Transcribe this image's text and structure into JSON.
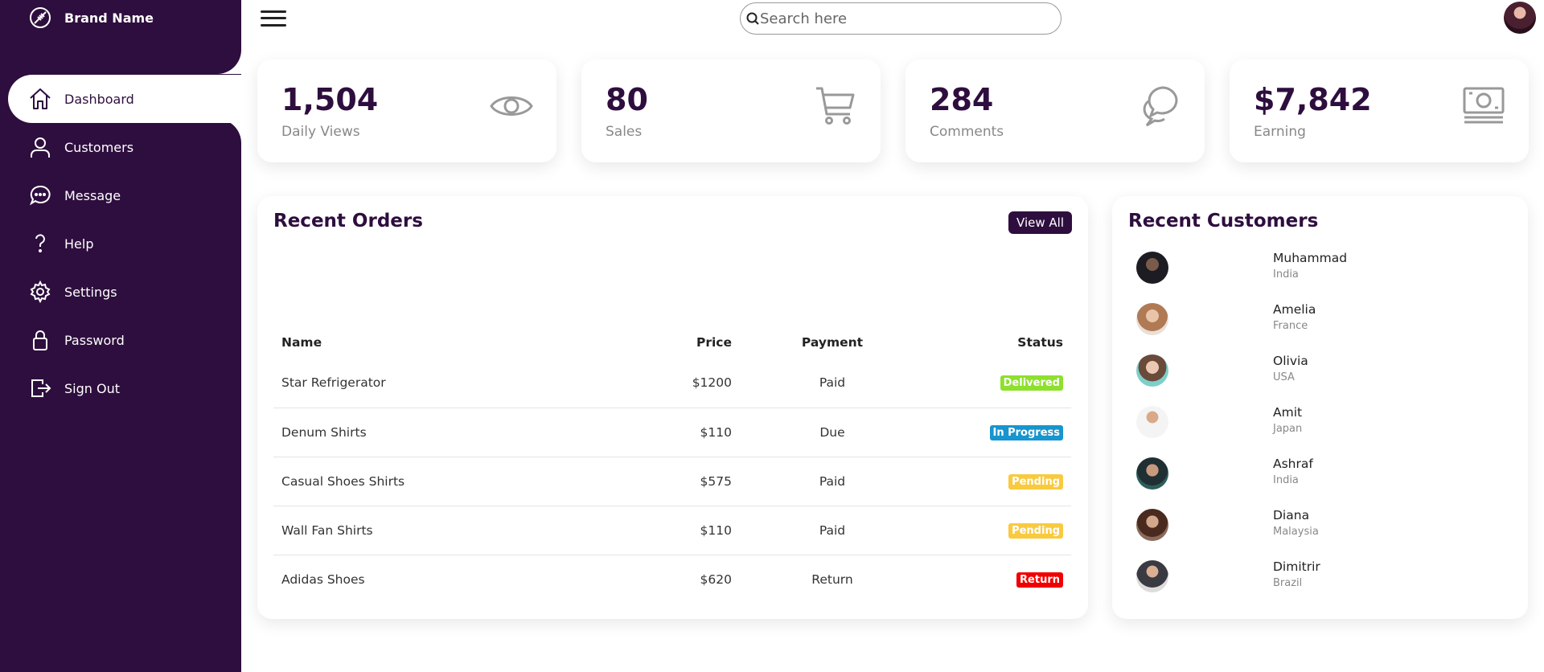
{
  "sidebar": {
    "brand": "Brand Name",
    "items": [
      {
        "label": "Dashboard",
        "icon": "home-icon"
      },
      {
        "label": "Customers",
        "icon": "person-icon"
      },
      {
        "label": "Message",
        "icon": "chat-icon"
      },
      {
        "label": "Help",
        "icon": "help-icon"
      },
      {
        "label": "Settings",
        "icon": "gear-icon"
      },
      {
        "label": "Password",
        "icon": "lock-icon"
      },
      {
        "label": "Sign Out",
        "icon": "sign-out-icon"
      }
    ],
    "colors": {
      "bg": "#2e0e3e",
      "active_bg": "#ffffff"
    }
  },
  "search": {
    "placeholder": "Search here"
  },
  "stats": [
    {
      "number": "1,504",
      "caption": "Daily Views",
      "icon": "eye-icon"
    },
    {
      "number": "80",
      "caption": "Sales",
      "icon": "cart-icon"
    },
    {
      "number": "284",
      "caption": "Comments",
      "icon": "comments-icon"
    },
    {
      "number": "$7,842",
      "caption": "Earning",
      "icon": "cash-icon"
    }
  ],
  "orders": {
    "title": "Recent Orders",
    "view_all": "View All",
    "headers": {
      "name": "Name",
      "price": "Price",
      "payment": "Payment",
      "status": "Status"
    },
    "rows": [
      {
        "name": "Star Refrigerator",
        "price": "$1200",
        "payment": "Paid",
        "status": "Delivered",
        "color": "#8de02c"
      },
      {
        "name": "Denum Shirts",
        "price": "$110",
        "payment": "Due",
        "status": "In Progress",
        "color": "#1795ce"
      },
      {
        "name": "Casual Shoes Shirts",
        "price": "$575",
        "payment": "Paid",
        "status": "Pending",
        "color": "#f9ca3f"
      },
      {
        "name": "Wall Fan Shirts",
        "price": "$110",
        "payment": "Paid",
        "status": "Pending",
        "color": "#f9ca3f"
      },
      {
        "name": "Adidas Shoes",
        "price": "$620",
        "payment": "Return",
        "status": "Return",
        "color": "#f00000"
      }
    ]
  },
  "customers": {
    "title": "Recent Customers",
    "list": [
      {
        "name": "Muhammad",
        "country": "India"
      },
      {
        "name": "Amelia",
        "country": "France"
      },
      {
        "name": "Olivia",
        "country": "USA"
      },
      {
        "name": "Amit",
        "country": "Japan"
      },
      {
        "name": "Ashraf",
        "country": "India"
      },
      {
        "name": "Diana",
        "country": "Malaysia"
      },
      {
        "name": "Dimitrir",
        "country": "Brazil"
      }
    ]
  }
}
